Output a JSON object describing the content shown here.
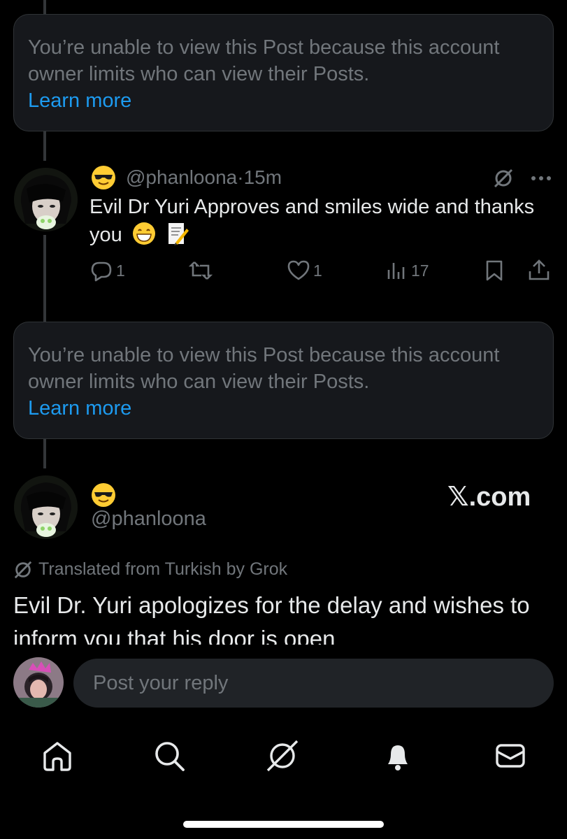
{
  "unavailable_1": {
    "message": "You’re unable to view this Post because this account owner limits who can view their Posts.",
    "link": "Learn more"
  },
  "reply_post": {
    "handle": "@phanloona",
    "separator": " · ",
    "time": "15m",
    "text": "Evil Dr Yuri Approves and smiles wide and thanks you",
    "icons": [
      "grok-icon",
      "more-icon"
    ],
    "actions": {
      "replies": "1",
      "likes": "1",
      "views": "17"
    }
  },
  "unavailable_2": {
    "message": "You’re unable to view this Post because this account owner limits who can view their Posts.",
    "link": "Learn more"
  },
  "focused_post": {
    "handle": "@phanloona",
    "brand": "𝕏.com",
    "translated_label": "Translated from Turkish by Grok",
    "text": "Evil Dr. Yuri apologizes for the delay and wishes to inform you that his door is open"
  },
  "reply_composer": {
    "placeholder": "Post your reply"
  },
  "nav": {
    "items": [
      "home-icon",
      "search-icon",
      "grok-icon",
      "notifications-icon",
      "messages-icon"
    ]
  },
  "colors": {
    "background": "#000000",
    "card": "#16181c",
    "muted": "#71767b",
    "link": "#1d9bf0",
    "text": "#e7e9ea"
  }
}
